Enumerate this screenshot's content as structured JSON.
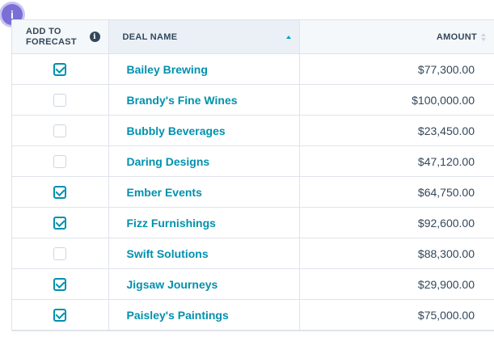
{
  "badge": {
    "label": "i"
  },
  "headers": {
    "forecast": "ADD TO FORECAST",
    "deal_name": "DEAL NAME",
    "amount": "AMOUNT"
  },
  "rows": [
    {
      "checked": true,
      "name": "Bailey Brewing",
      "amount": "$77,300.00"
    },
    {
      "checked": false,
      "name": "Brandy's Fine Wines",
      "amount": "$100,000.00"
    },
    {
      "checked": false,
      "name": "Bubbly Beverages",
      "amount": "$23,450.00"
    },
    {
      "checked": false,
      "name": "Daring Designs",
      "amount": "$47,120.00"
    },
    {
      "checked": true,
      "name": "Ember Events",
      "amount": "$64,750.00"
    },
    {
      "checked": true,
      "name": "Fizz Furnishings",
      "amount": "$92,600.00"
    },
    {
      "checked": false,
      "name": "Swift Solutions",
      "amount": "$88,300.00"
    },
    {
      "checked": true,
      "name": "Jigsaw Journeys",
      "amount": "$29,900.00"
    },
    {
      "checked": true,
      "name": "Paisley's Paintings",
      "amount": "$75,000.00"
    }
  ],
  "colors": {
    "accent": "#0091ae",
    "badge": "#7b6fd6",
    "text": "#33475b",
    "border": "#dfe3eb"
  },
  "icons": {
    "header_info": "info-icon",
    "sort": "sort-icon"
  }
}
